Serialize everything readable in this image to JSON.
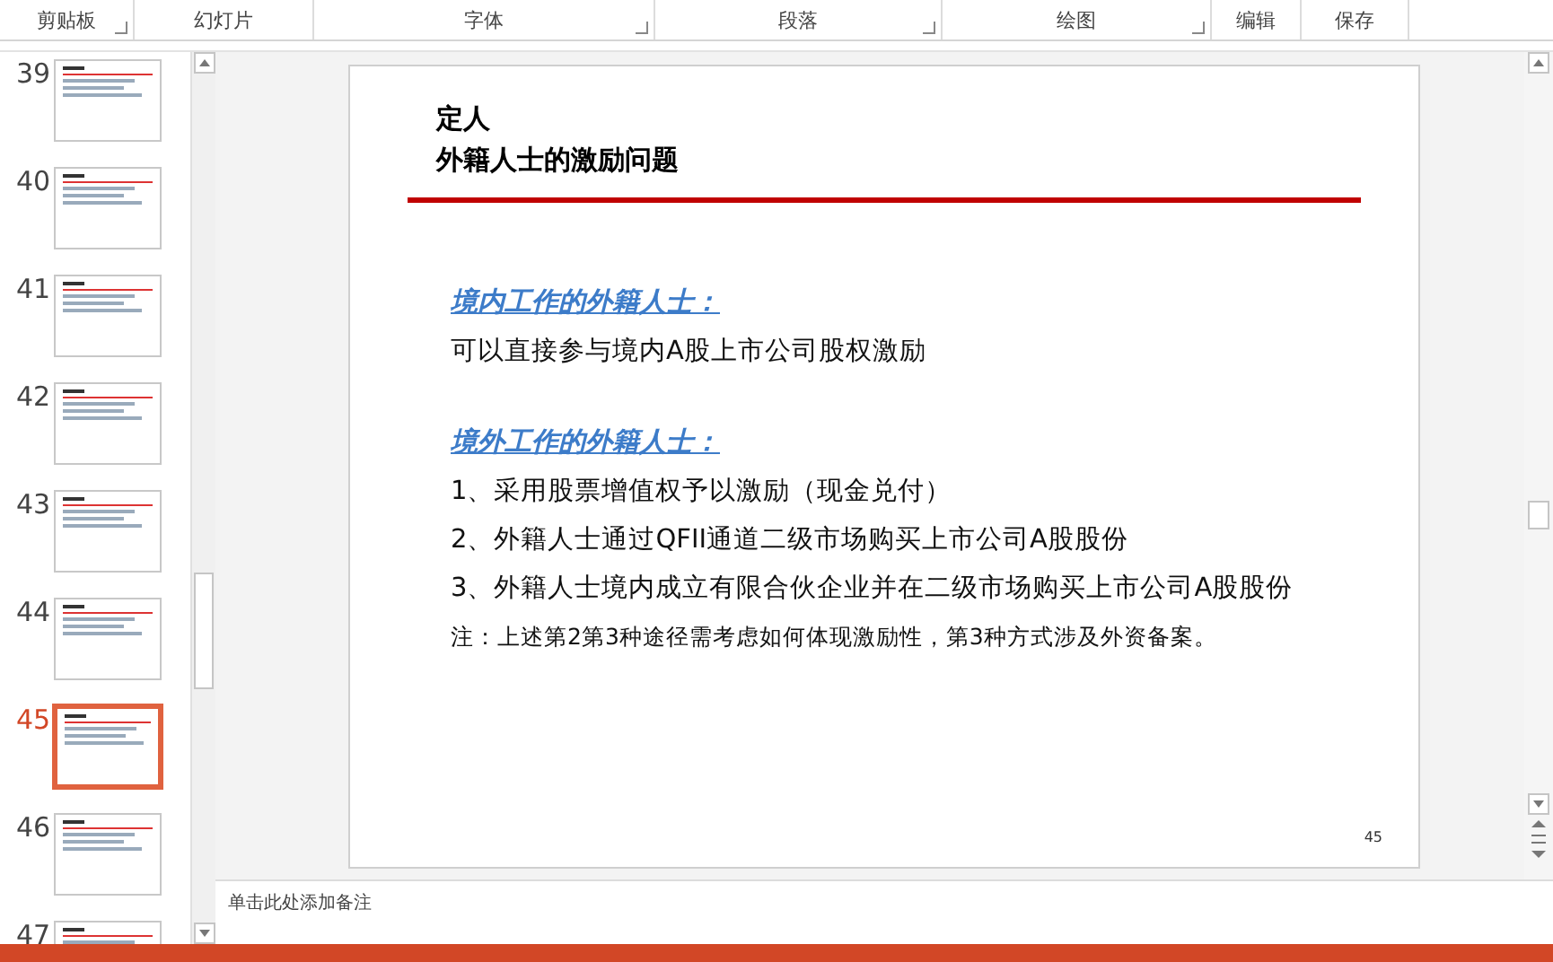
{
  "ribbon": {
    "groups": [
      {
        "label": "剪贴板",
        "launcher": true
      },
      {
        "label": "幻灯片",
        "launcher": false
      },
      {
        "label": "字体",
        "launcher": true
      },
      {
        "label": "段落",
        "launcher": true
      },
      {
        "label": "绘图",
        "launcher": true
      },
      {
        "label": "编辑",
        "launcher": false
      },
      {
        "label": "保存",
        "launcher": false
      }
    ]
  },
  "thumbnails": [
    {
      "number": "39",
      "selected": false
    },
    {
      "number": "40",
      "selected": false
    },
    {
      "number": "41",
      "selected": false
    },
    {
      "number": "42",
      "selected": false
    },
    {
      "number": "43",
      "selected": false
    },
    {
      "number": "44",
      "selected": false
    },
    {
      "number": "45",
      "selected": true
    },
    {
      "number": "46",
      "selected": false
    },
    {
      "number": "47",
      "selected": false
    }
  ],
  "slide": {
    "title": [
      "定人",
      "外籍人士的激励问题"
    ],
    "body": [
      {
        "kind": "heading",
        "text": "境内工作的外籍人士："
      },
      {
        "kind": "item",
        "text": "可以直接参与境内A股上市公司股权激励"
      },
      {
        "kind": "heading",
        "text": "境外工作的外籍人士："
      },
      {
        "kind": "item",
        "text": "1、采用股票增值权予以激励（现金兑付）"
      },
      {
        "kind": "item",
        "text": "2、外籍人士通过QFII通道二级市场购买上市公司A股股份"
      },
      {
        "kind": "item",
        "text": "3、外籍人士境内成立有限合伙企业并在二级市场购买上市公司A股股份"
      },
      {
        "kind": "note",
        "text": "注：上述第2第3种途径需考虑如何体现激励性，第3种方式涉及外资备案。"
      }
    ],
    "page_number": "45"
  },
  "notes": {
    "placeholder": "单击此处添加备注"
  }
}
